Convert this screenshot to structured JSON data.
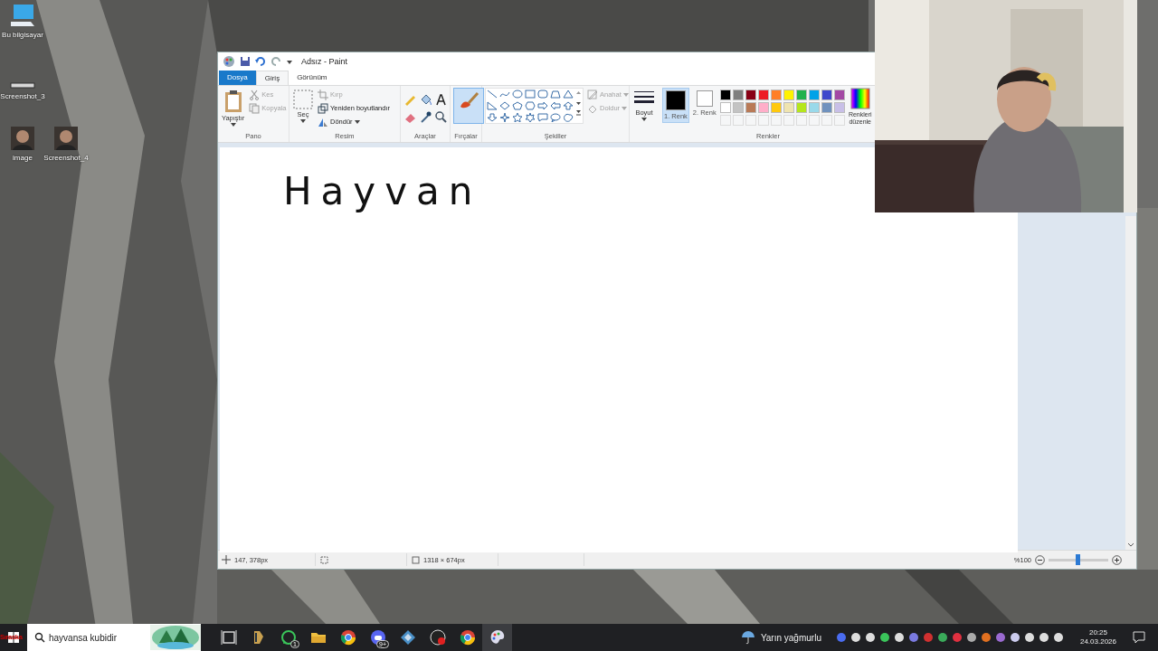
{
  "desktop_icons": [
    {
      "label": "Bu bilgisayar",
      "kind": "computer"
    },
    {
      "label": "Screenshot_3",
      "kind": "screenshot"
    },
    {
      "label": "image"
    },
    {
      "label": "Screenshot_4"
    }
  ],
  "window": {
    "title": "Adsız - Paint"
  },
  "tabs": [
    {
      "label": "Dosya",
      "kind": "file",
      "selected": false
    },
    {
      "label": "Giriş",
      "kind": "tab",
      "selected": true
    },
    {
      "label": "Görünüm",
      "kind": "tab",
      "selected": false
    }
  ],
  "ribbon": {
    "clipboard": {
      "label": "Pano",
      "paste": "Yapıştır",
      "items": [
        {
          "label": "Kes",
          "kind": "cut",
          "disabled": true
        },
        {
          "label": "Kopyala",
          "kind": "copy",
          "disabled": true
        }
      ]
    },
    "image": {
      "label": "Resim",
      "select": "Seç",
      "items": [
        {
          "label": "Kırp",
          "kind": "crop",
          "disabled": true
        },
        {
          "label": "Yeniden boyutlandır",
          "kind": "resize",
          "disabled": false
        },
        {
          "label": "Döndür",
          "kind": "rotate",
          "disabled": false
        }
      ]
    },
    "tools": {
      "label": "Araçlar"
    },
    "brushes": {
      "label": "Fırçalar",
      "selected": true
    },
    "shapes": {
      "label": "Şekiller",
      "items": [
        {
          "label": "Anahat",
          "disabled": true
        },
        {
          "label": "Doldur",
          "disabled": true
        }
      ]
    },
    "size": {
      "label": "Boyut"
    },
    "colors": {
      "label": "Renkler",
      "slots": [
        {
          "label": "1. Renk",
          "color": "#000000",
          "selected": true
        },
        {
          "label": "2. Renk",
          "color": "#ffffff",
          "selected": false
        }
      ],
      "palette": [
        {
          "color": "#000000"
        },
        {
          "color": "#7f7f7f"
        },
        {
          "color": "#880015"
        },
        {
          "color": "#ed1c24"
        },
        {
          "color": "#ff7f27"
        },
        {
          "color": "#fff200"
        },
        {
          "color": "#22b14c"
        },
        {
          "color": "#00a2e8"
        },
        {
          "color": "#3f48cc"
        },
        {
          "color": "#a349a4"
        },
        {
          "color": "#ffffff"
        },
        {
          "color": "#c3c3c3"
        },
        {
          "color": "#b97a57"
        },
        {
          "color": "#ffaec9"
        },
        {
          "color": "#ffc90e"
        },
        {
          "color": "#efe4b0"
        },
        {
          "color": "#b5e61d"
        },
        {
          "color": "#99d9ea"
        },
        {
          "color": "#7092be"
        },
        {
          "color": "#c8bfe7"
        }
      ],
      "edit": "Renkleri düzenle"
    }
  },
  "canvas": {
    "text": "Hayvan"
  },
  "status_bar": {
    "position": "147, 378px",
    "size": "1318 × 674px",
    "zoom": "%100",
    "zoom_level": {
      "level": 0.48
    }
  },
  "taskbar": {
    "overlay": "Sıraska",
    "search": {
      "value": "hayvansa kubidir"
    },
    "apps": [
      {
        "kind": "taskview",
        "active": false
      },
      {
        "kind": "game",
        "active": false
      },
      {
        "kind": "chat",
        "badge": "1",
        "active": false
      },
      {
        "kind": "folder",
        "active": false
      },
      {
        "kind": "browser",
        "active": false
      },
      {
        "kind": "voice",
        "badge": "9+",
        "active": false
      },
      {
        "kind": "cube",
        "active": false
      },
      {
        "kind": "record",
        "active": false
      },
      {
        "kind": "browser",
        "active": false
      },
      {
        "kind": "paint",
        "active": true
      }
    ],
    "weather": "Yarın yağmurlu",
    "time": "20:25",
    "date": "24.03.2026"
  }
}
